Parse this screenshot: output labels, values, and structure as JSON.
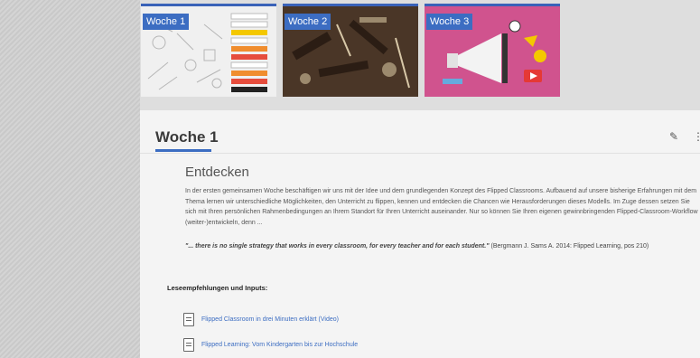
{
  "tiles": [
    {
      "label": "Woche 1"
    },
    {
      "label": "Woche 2"
    },
    {
      "label": "Woche 3"
    }
  ],
  "panel": {
    "title": "Woche 1",
    "section_heading": "Entdecken",
    "intro": "In der ersten gemeinsamen Woche beschäftigen wir uns mit der Idee und dem grundlegenden Konzept des Flipped Classrooms. Aufbauend auf unsere bisherige Erfahrungen mit dem Thema lernen wir unterschiedliche Möglichkeiten, den Unterricht zu flippen, kennen und entdecken die Chancen wie Herausforderungen dieses Modells. Im Zuge dessen setzen Sie sich mit Ihren persönlichen Rahmenbedingungen an Ihrem Standort für Ihren Unterricht auseinander. Nur so können Sie Ihren eigenen gewinnbringenden Flipped-Classroom-Workflow (weiter-)entwickeln, denn ...",
    "quote_text": "\"... there is no single strategy that works in every classroom, for every teacher and for each student.\"",
    "quote_source": "(Bergmann J. Sams A. 2014: Flipped Learning, pos 210)",
    "reading_heading": "Leseempfehlungen und Inputs:",
    "links": [
      {
        "label": "Flipped Classroom in drei Minuten erklärt (Video)"
      },
      {
        "label": "Flipped Learning: Vom Kindergarten bis zur Hochschule"
      }
    ]
  },
  "colors": {
    "accent": "#3c6dc2",
    "tile3_bg": "#d0538e",
    "tile2_bg": "#4a3627"
  }
}
